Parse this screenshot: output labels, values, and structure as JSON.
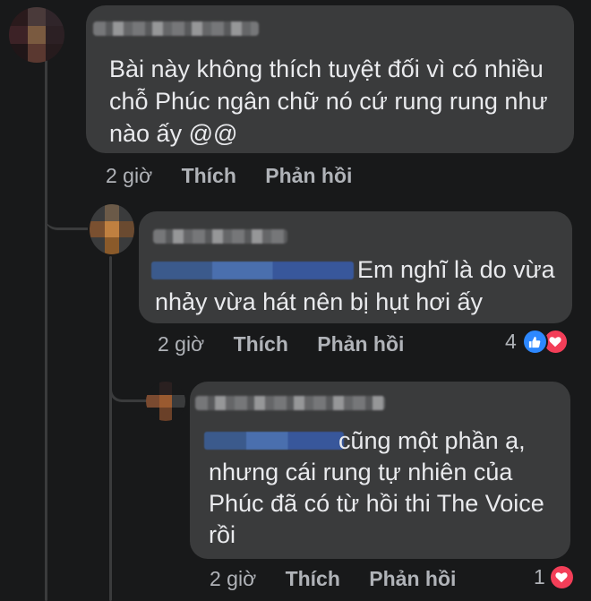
{
  "comments": [
    {
      "text_lines": [
        "Bài này không thích tuyệt đối vì có nhiều",
        "chỗ Phúc ngân chữ  nó cứ rung rung như",
        "nào ấy @@"
      ],
      "time": "2 giờ",
      "like_label": "Thích",
      "reply_label": "Phản hồi"
    },
    {
      "text_lines": [
        "Em nghĩ là do vừa",
        "nhảy vừa hát nên bị hụt hơi ấy"
      ],
      "time": "2 giờ",
      "like_label": "Thích",
      "reply_label": "Phản hồi",
      "reaction_count": "4",
      "reaction_icons": [
        "like-icon",
        "love-icon"
      ]
    },
    {
      "text_lines": [
        "cũng một phần ạ,",
        "nhưng cái rung tự nhiên của",
        "Phúc đã có từ hồi thi The Voice",
        "rồi"
      ],
      "time": "2 giờ",
      "like_label": "Thích",
      "reply_label": "Phản hồi",
      "reaction_count": "1",
      "reaction_icons": [
        "love-icon"
      ]
    }
  ],
  "colors": {
    "background": "#18191a",
    "bubble": "#3a3b3c",
    "meta": "#b0b3b8",
    "like": "#2d88ff",
    "love": "#f33e58"
  }
}
